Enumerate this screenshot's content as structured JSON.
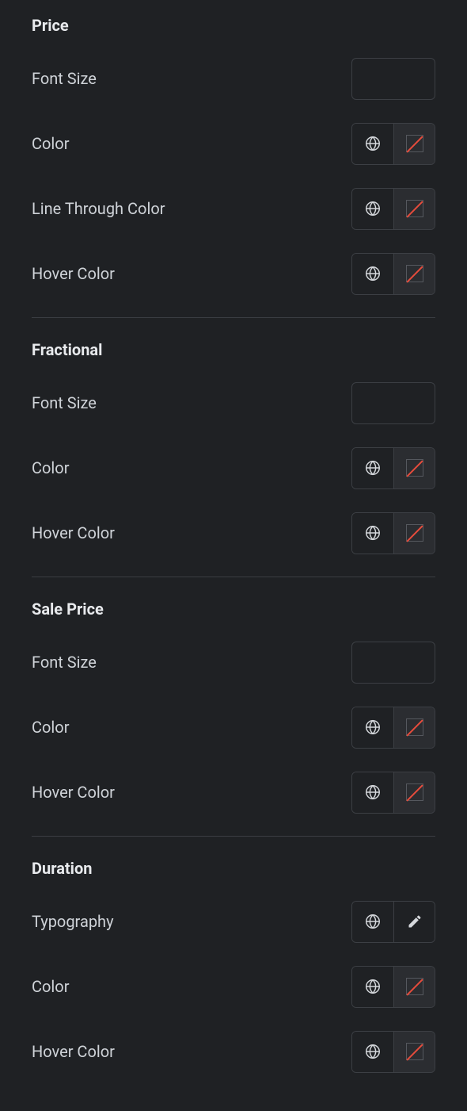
{
  "sections": {
    "price": {
      "heading": "Price",
      "font_size_label": "Font Size",
      "font_size_value": "",
      "color_label": "Color",
      "line_through_color_label": "Line Through Color",
      "hover_color_label": "Hover Color"
    },
    "fractional": {
      "heading": "Fractional",
      "font_size_label": "Font Size",
      "font_size_value": "",
      "color_label": "Color",
      "hover_color_label": "Hover Color"
    },
    "sale_price": {
      "heading": "Sale Price",
      "font_size_label": "Font Size",
      "font_size_value": "",
      "color_label": "Color",
      "hover_color_label": "Hover Color"
    },
    "duration": {
      "heading": "Duration",
      "typography_label": "Typography",
      "color_label": "Color",
      "hover_color_label": "Hover Color"
    }
  }
}
